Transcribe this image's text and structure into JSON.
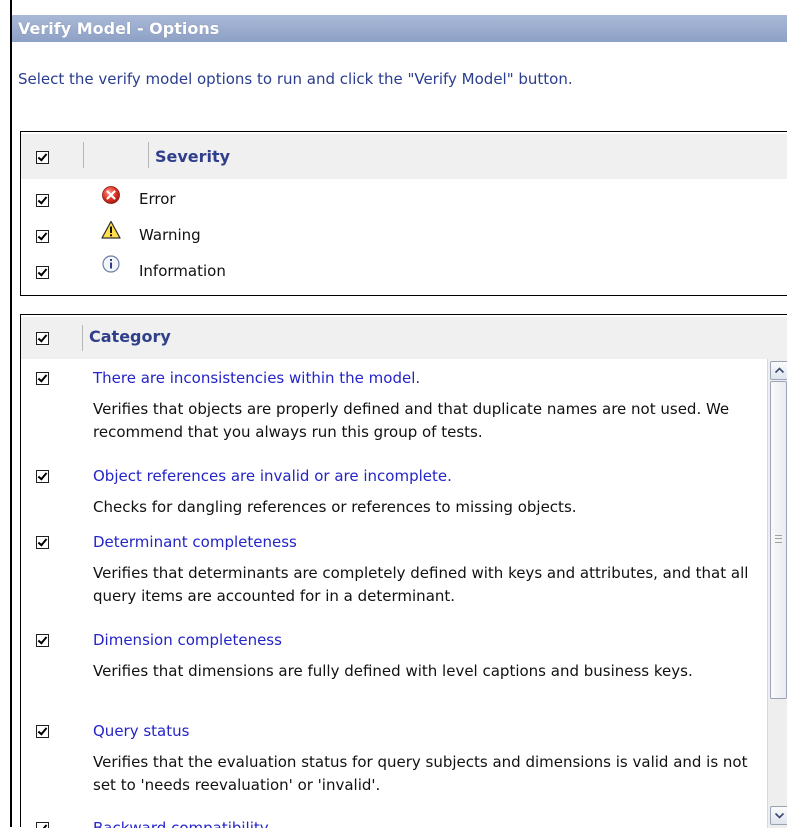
{
  "dialog": {
    "title": "Verify Model - Options",
    "instruction": "Select the verify model options to run and click the \"Verify Model\" button."
  },
  "severity": {
    "header": "Severity",
    "all_checked": true,
    "items": [
      {
        "label": "Error",
        "icon": "error-icon",
        "checked": true
      },
      {
        "label": "Warning",
        "icon": "warning-icon",
        "checked": true
      },
      {
        "label": "Information",
        "icon": "information-icon",
        "checked": true
      }
    ]
  },
  "category": {
    "header": "Category",
    "all_checked": true,
    "items": [
      {
        "title": "There are inconsistencies within the model.",
        "description": "Verifies that objects are properly defined and that duplicate names are not used. We recommend that you always run this group of tests.",
        "checked": true
      },
      {
        "title": "Object references are invalid or are incomplete.",
        "description": "Checks for dangling references or references to missing objects.",
        "checked": true
      },
      {
        "title": "Determinant completeness",
        "description": "Verifies that determinants are completely defined with keys and attributes, and that all query items are accounted for in a determinant.",
        "checked": true
      },
      {
        "title": "Dimension completeness",
        "description": "Verifies that dimensions are fully defined with level captions and business keys.",
        "checked": true
      },
      {
        "title": "Query status",
        "description": "Verifies that the evaluation status for query subjects and dimensions is valid and is not set to 'needs reevaluation' or 'invalid'.",
        "checked": true
      },
      {
        "title": "Backward compatibility",
        "description": "",
        "checked": true
      }
    ]
  },
  "colors": {
    "title_bar": "#9aabcf",
    "link_text": "#2424c8",
    "header_text": "#2f3f8a"
  }
}
